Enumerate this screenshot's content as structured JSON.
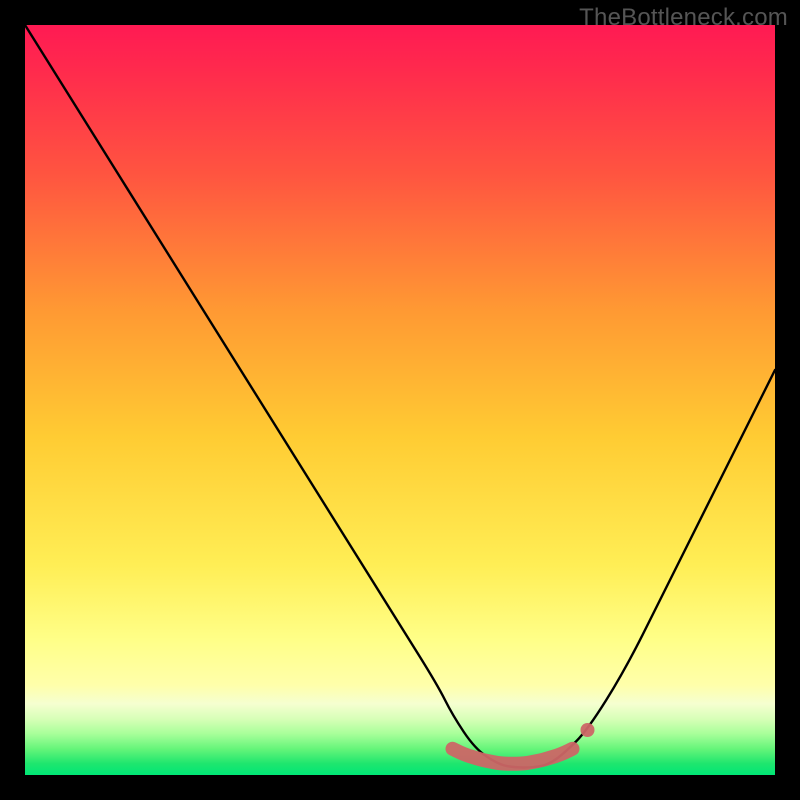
{
  "watermark": "TheBottleneck.com",
  "colors": {
    "bg": "#000000",
    "gradient_top": "#ff1a53",
    "gradient_mid_upper": "#ff7a33",
    "gradient_mid": "#ffd633",
    "gradient_lower": "#ffff99",
    "gradient_bottom": "#00e676",
    "curve": "#000000",
    "marker": "#cc6666"
  },
  "chart_data": {
    "type": "line",
    "title": "",
    "xlabel": "",
    "ylabel": "",
    "xlim": [
      0,
      100
    ],
    "ylim": [
      0,
      100
    ],
    "series": [
      {
        "name": "bottleneck-curve",
        "x": [
          0,
          5,
          10,
          15,
          20,
          25,
          30,
          35,
          40,
          45,
          50,
          55,
          57,
          60,
          63,
          65,
          68,
          70,
          72,
          75,
          80,
          85,
          90,
          95,
          100
        ],
        "y": [
          100,
          92,
          84,
          76,
          68,
          60,
          52,
          44,
          36,
          28,
          20,
          12,
          8,
          3.5,
          1.5,
          1,
          1,
          1.5,
          3,
          6,
          14,
          24,
          34,
          44,
          54
        ]
      }
    ],
    "markers": {
      "name": "highlight-band",
      "x": [
        57,
        58,
        59,
        60,
        61,
        62,
        63,
        64,
        65,
        66,
        67,
        68,
        69,
        70,
        71,
        72,
        73
      ],
      "y": [
        3.5,
        3.0,
        2.6,
        2.3,
        2.0,
        1.8,
        1.6,
        1.5,
        1.5,
        1.5,
        1.6,
        1.8,
        2.0,
        2.3,
        2.6,
        3.0,
        3.5
      ]
    },
    "extra_dot": {
      "x": 75,
      "y": 6
    }
  }
}
